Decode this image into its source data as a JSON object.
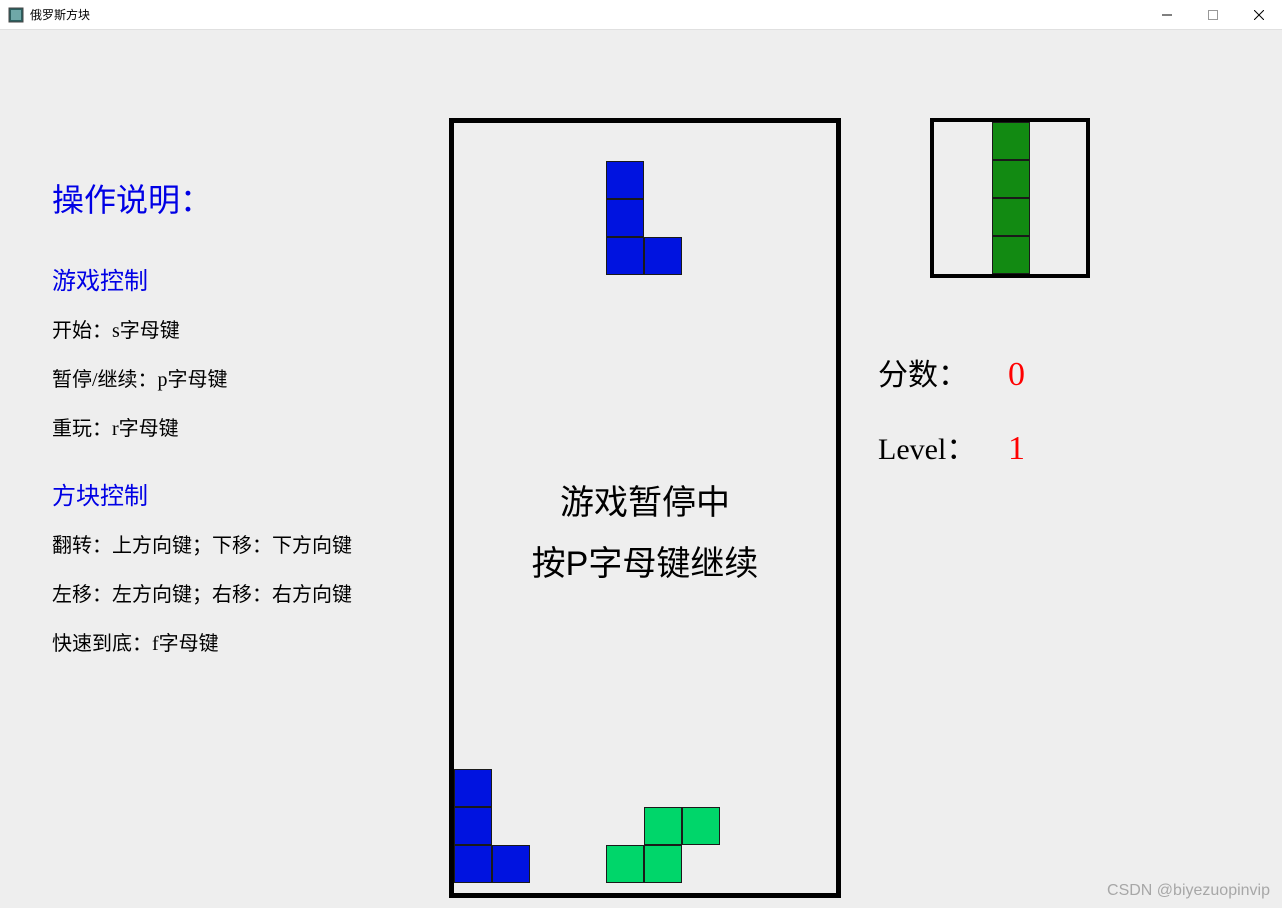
{
  "window": {
    "title": "俄罗斯方块"
  },
  "instructions": {
    "header": "操作说明：",
    "section1": {
      "title": "游戏控制",
      "lines": [
        "开始：s字母键",
        "暂停/继续：p字母键",
        "重玩：r字母键"
      ]
    },
    "section2": {
      "title": "方块控制",
      "lines": [
        "翻转：上方向键；下移：下方向键",
        "左移：左方向键；右移：右方向键",
        "快速到底：f字母键"
      ]
    }
  },
  "playfield": {
    "cols": 10,
    "rows": 20,
    "cell_size_px": 38,
    "overlay": {
      "line1": "游戏暂停中",
      "line2": "按P字母键继续"
    },
    "cells": [
      {
        "col": 4,
        "row": 1,
        "color": "#0013e0"
      },
      {
        "col": 4,
        "row": 2,
        "color": "#0013e0"
      },
      {
        "col": 4,
        "row": 3,
        "color": "#0013e0"
      },
      {
        "col": 5,
        "row": 3,
        "color": "#0013e0"
      },
      {
        "col": 0,
        "row": 17,
        "color": "#0013e0"
      },
      {
        "col": 0,
        "row": 18,
        "color": "#0013e0"
      },
      {
        "col": 0,
        "row": 19,
        "color": "#0013e0"
      },
      {
        "col": 1,
        "row": 19,
        "color": "#0013e0"
      },
      {
        "col": 5,
        "row": 18,
        "color": "#00d66a"
      },
      {
        "col": 6,
        "row": 18,
        "color": "#00d66a"
      },
      {
        "col": 4,
        "row": 19,
        "color": "#00d66a"
      },
      {
        "col": 5,
        "row": 19,
        "color": "#00d66a"
      }
    ]
  },
  "preview": {
    "cols": 4,
    "rows": 4,
    "cell_size_px": 38,
    "cells": [
      {
        "col": 2,
        "row": 0,
        "color": "#128a12"
      },
      {
        "col": 2,
        "row": 1,
        "color": "#128a12"
      },
      {
        "col": 2,
        "row": 2,
        "color": "#128a12"
      },
      {
        "col": 2,
        "row": 3,
        "color": "#128a12"
      }
    ]
  },
  "score": {
    "score_label": "分数：",
    "score_value": "0",
    "level_label": "Level：",
    "level_value": "1"
  },
  "watermark": "CSDN @biyezuopinvip"
}
